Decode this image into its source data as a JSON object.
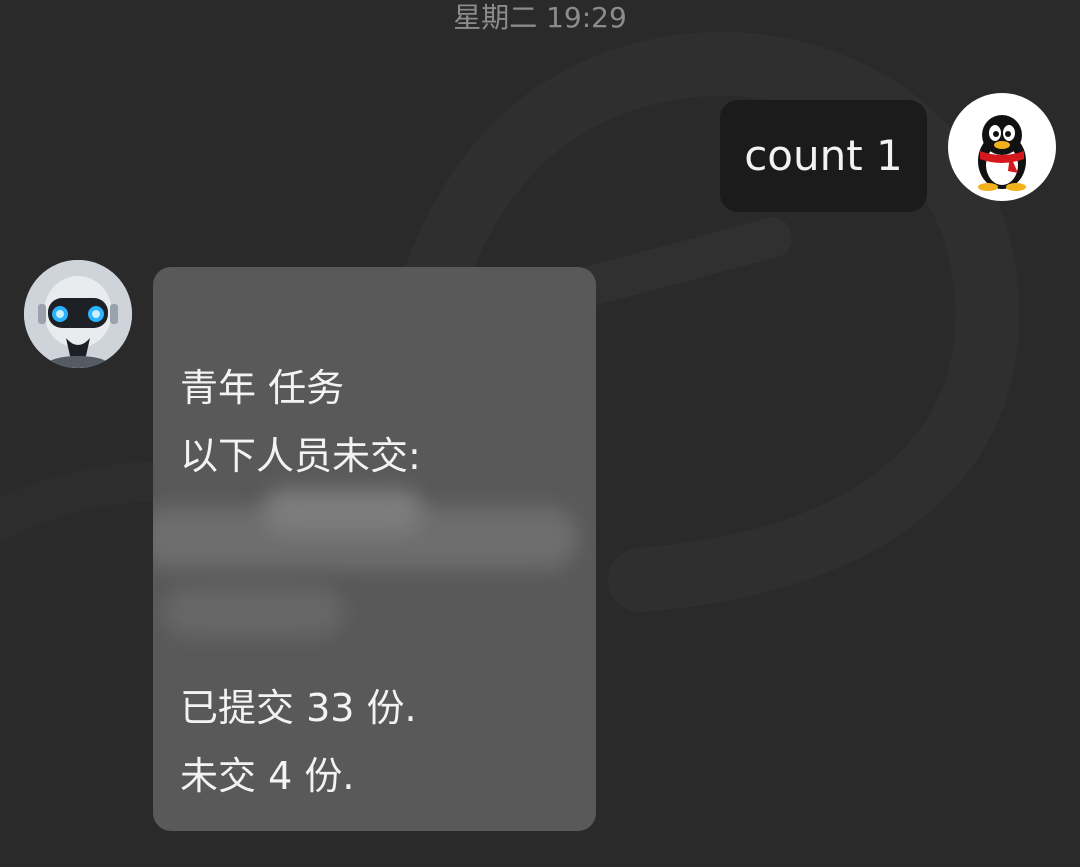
{
  "header": {
    "timestamp": "星期二 19:29"
  },
  "messages": [
    {
      "sender": "self",
      "avatar_icon": "qq-penguin-icon",
      "text": "count 1"
    },
    {
      "sender": "bot",
      "avatar_icon": "robot-head-icon",
      "title": "青年 任务",
      "subtitle": "以下人员未交:",
      "submitted": "已提交 33 份.",
      "not_submitted": "未交 4 份."
    }
  ],
  "colors": {
    "background": "#2a2a2a",
    "self_bubble": "#1b1b1b",
    "bot_bubble": "#595959",
    "text": "#f2f2f2",
    "timestamp": "#8c8c8c"
  }
}
